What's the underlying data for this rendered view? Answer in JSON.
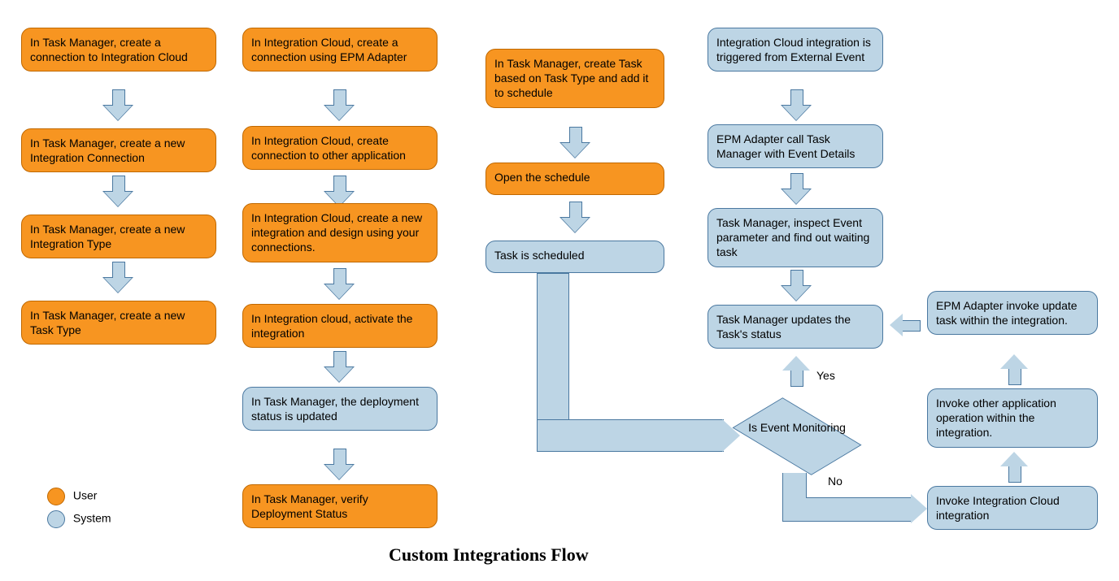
{
  "title": "Custom Integrations Flow",
  "legend": {
    "user": "User",
    "system": "System"
  },
  "col1": {
    "b1": "In Task Manager, create a connection to Integration Cloud",
    "b2": "In Task Manager, create a new Integration Connection",
    "b3": "In Task Manager, create a new Integration Type",
    "b4": "In Task Manager, create a new Task Type"
  },
  "col2": {
    "b1": "In Integration Cloud, create a connection using EPM Adapter",
    "b2": "In Integration Cloud, create connection to other application",
    "b3": "In Integration Cloud, create a new integration and design using your connections.",
    "b4": "In Integration cloud, activate the integration",
    "b5": "In Task Manager, the deployment status is updated",
    "b6": "In Task Manager, verify Deployment Status"
  },
  "col3": {
    "b1": "In Task Manager, create Task based on Task Type and add it to schedule",
    "b2": "Open the schedule",
    "b3": "Task is scheduled"
  },
  "col4": {
    "b1": "Integration Cloud integration is triggered from External Event",
    "b2": "EPM Adapter call Task Manager with Event Details",
    "b3": "Task Manager, inspect Event parameter and find out waiting task",
    "b4": "Task Manager updates the  Task's status"
  },
  "decision": {
    "label": "Is Event Monitoring",
    "yes": "Yes",
    "no": "No"
  },
  "col5": {
    "b1": "EPM Adapter invoke update task within the integration.",
    "b2": "Invoke other application operation within the integration.",
    "b3": "Invoke Integration Cloud integration"
  }
}
